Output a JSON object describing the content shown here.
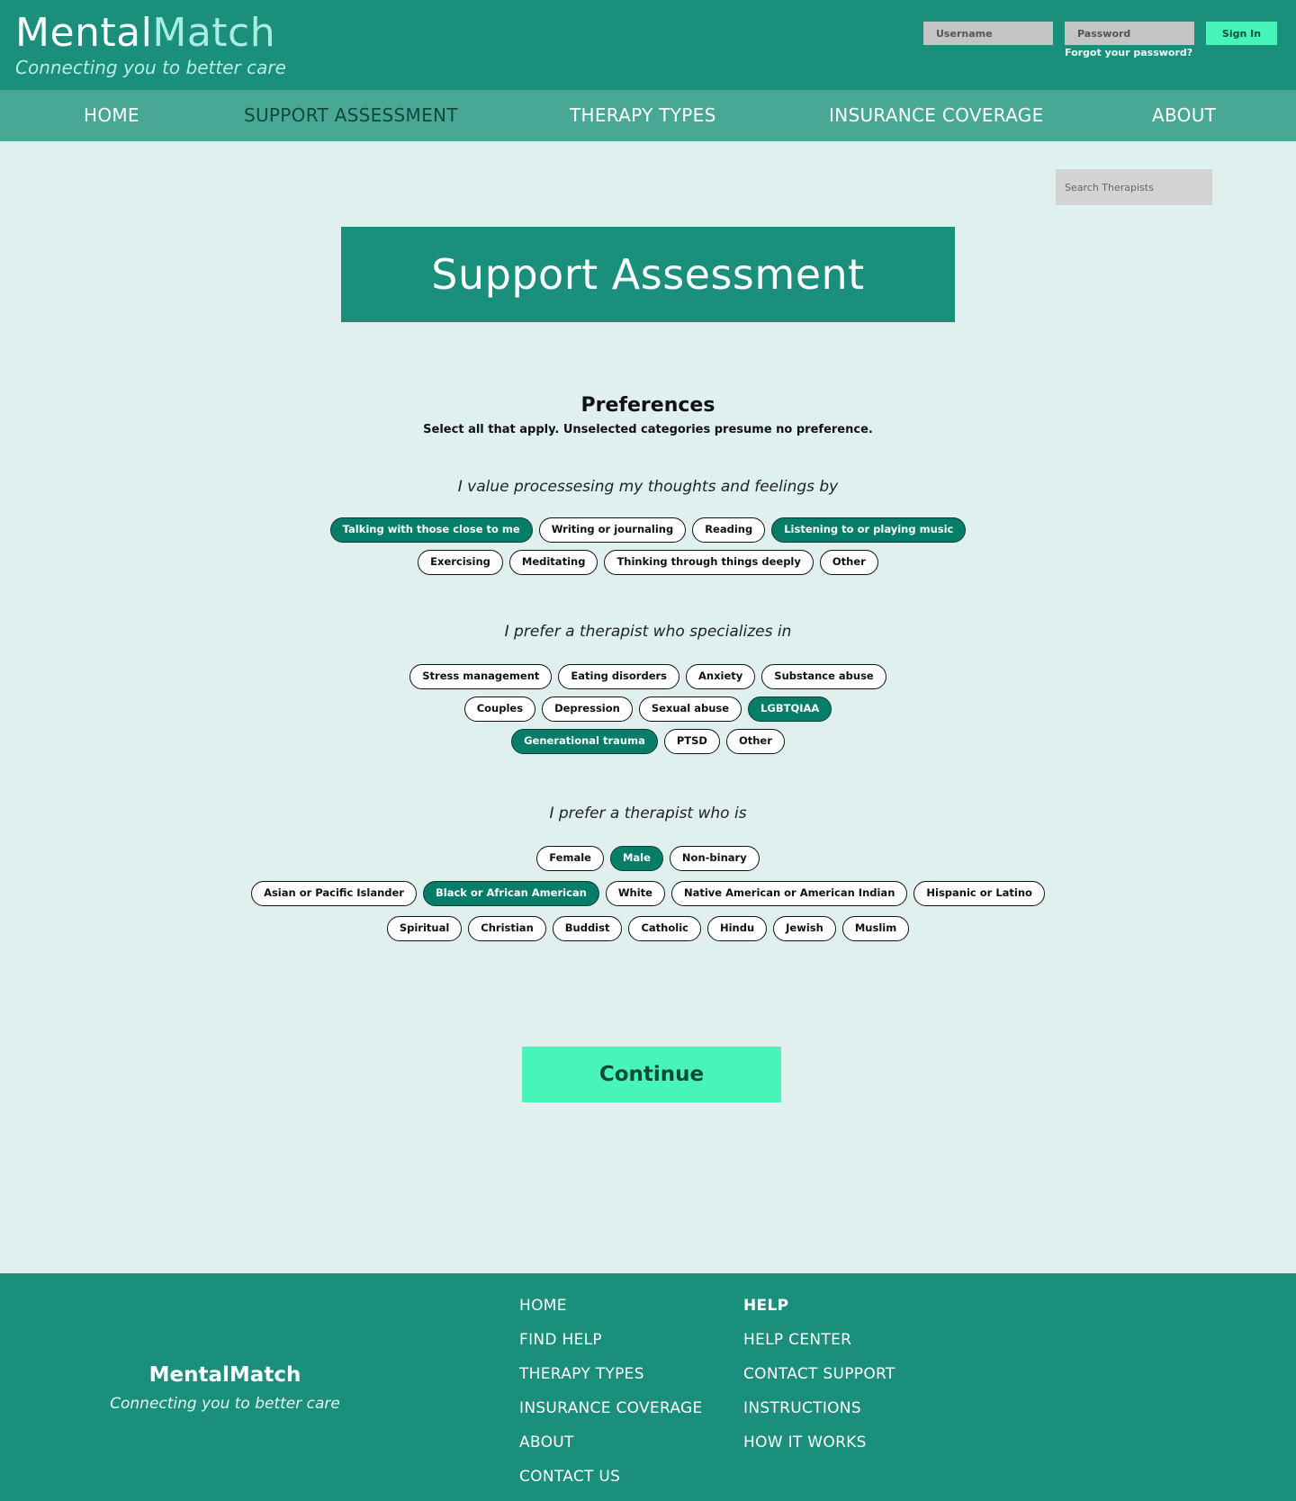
{
  "header": {
    "brand_part1": "Mental",
    "brand_part2": "Match",
    "tagline": "Connecting you to better care",
    "username_placeholder": "Username",
    "password_placeholder": "Password",
    "signin_label": "Sign In",
    "forgot_label": "Forgot your password?"
  },
  "nav": {
    "items": [
      {
        "label": "HOME",
        "active": false
      },
      {
        "label": "SUPPORT ASSESSMENT",
        "active": true
      },
      {
        "label": "THERAPY TYPES",
        "active": false
      },
      {
        "label": "INSURANCE COVERAGE",
        "active": false
      },
      {
        "label": "ABOUT",
        "active": false
      }
    ]
  },
  "search": {
    "placeholder": "Search Therapists"
  },
  "page": {
    "title": "Support Assessment"
  },
  "preferences": {
    "title": "Preferences",
    "subtitle": "Select all that apply. Unselected categories presume no preference.",
    "q1": {
      "label": "I value processesing my thoughts and feelings by",
      "row1": [
        {
          "label": "Talking with those close to me",
          "selected": true
        },
        {
          "label": "Writing or journaling",
          "selected": false
        },
        {
          "label": "Reading",
          "selected": false
        },
        {
          "label": "Listening to or playing music",
          "selected": true
        }
      ],
      "row2": [
        {
          "label": "Exercising",
          "selected": false
        },
        {
          "label": "Meditating",
          "selected": false
        },
        {
          "label": "Thinking through things deeply",
          "selected": false
        },
        {
          "label": "Other",
          "selected": false
        }
      ]
    },
    "q2": {
      "label": "I prefer a therapist who specializes in",
      "row1": [
        {
          "label": "Stress management",
          "selected": false
        },
        {
          "label": "Eating disorders",
          "selected": false
        },
        {
          "label": "Anxiety",
          "selected": false
        },
        {
          "label": "Substance abuse",
          "selected": false
        }
      ],
      "row2": [
        {
          "label": "Couples",
          "selected": false
        },
        {
          "label": "Depression",
          "selected": false
        },
        {
          "label": "Sexual abuse",
          "selected": false
        },
        {
          "label": "LGBTQIAA",
          "selected": true
        }
      ],
      "row3": [
        {
          "label": "Generational trauma",
          "selected": true
        },
        {
          "label": "PTSD",
          "selected": false
        },
        {
          "label": "Other",
          "selected": false
        }
      ]
    },
    "q3": {
      "label": "I prefer a therapist who is",
      "row1": [
        {
          "label": "Female",
          "selected": false
        },
        {
          "label": "Male",
          "selected": true
        },
        {
          "label": "Non-binary",
          "selected": false
        }
      ],
      "row2": [
        {
          "label": "Asian or Pacific Islander",
          "selected": false
        },
        {
          "label": "Black or African American",
          "selected": true
        },
        {
          "label": "White",
          "selected": false
        },
        {
          "label": "Native American or American Indian",
          "selected": false
        },
        {
          "label": "Hispanic or Latino",
          "selected": false
        }
      ],
      "row3": [
        {
          "label": "Spiritual",
          "selected": false
        },
        {
          "label": "Christian",
          "selected": false
        },
        {
          "label": "Buddist",
          "selected": false
        },
        {
          "label": "Catholic",
          "selected": false
        },
        {
          "label": "Hindu",
          "selected": false
        },
        {
          "label": "Jewish",
          "selected": false
        },
        {
          "label": "Muslim",
          "selected": false
        }
      ]
    }
  },
  "continue_label": "Continue",
  "footer": {
    "brand": "MentalMatch",
    "tagline": "Connecting you to better care",
    "col1": [
      "HOME",
      "FIND HELP",
      "THERAPY TYPES",
      "INSURANCE COVERAGE",
      "ABOUT",
      "CONTACT US"
    ],
    "col2_heading": "HELP",
    "col2": [
      "HELP CENTER",
      "CONTACT SUPPORT",
      "INSTRUCTIONS",
      "HOW IT WORKS"
    ]
  },
  "colors": {
    "primary": "#1a8f7b",
    "nav_bg": "#49a796",
    "accent": "#48f5b8",
    "selected_chip": "#067d69",
    "page_bg": "#dff0ef"
  }
}
